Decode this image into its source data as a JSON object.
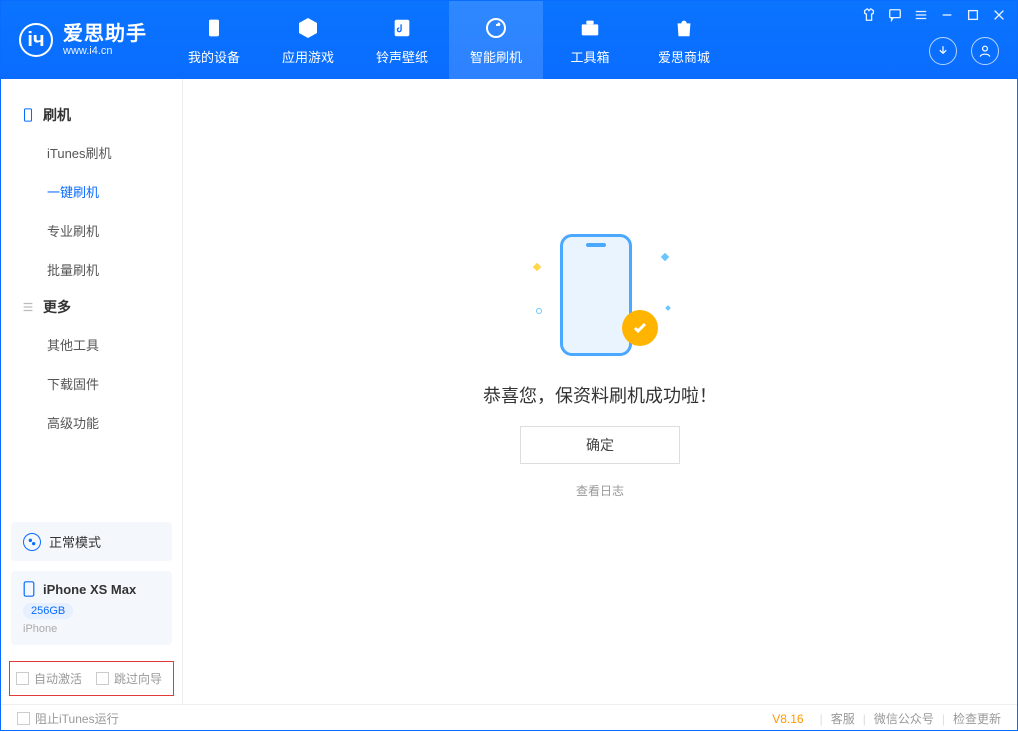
{
  "app": {
    "title": "爱思助手",
    "url": "www.i4.cn"
  },
  "nav": {
    "device": "我的设备",
    "apps": "应用游戏",
    "ringtone": "铃声壁纸",
    "flash": "智能刷机",
    "toolbox": "工具箱",
    "store": "爱思商城"
  },
  "sidebar": {
    "group_flash": "刷机",
    "items_flash": {
      "itunes": "iTunes刷机",
      "onekey": "一键刷机",
      "pro": "专业刷机",
      "batch": "批量刷机"
    },
    "group_more": "更多",
    "items_more": {
      "other": "其他工具",
      "firmware": "下载固件",
      "advanced": "高级功能"
    }
  },
  "device": {
    "mode": "正常模式",
    "name": "iPhone XS Max",
    "storage": "256GB",
    "type": "iPhone"
  },
  "options": {
    "auto_activate": "自动激活",
    "skip_guide": "跳过向导"
  },
  "main": {
    "success": "恭喜您，保资料刷机成功啦！",
    "confirm": "确定",
    "view_log": "查看日志"
  },
  "footer": {
    "block_itunes": "阻止iTunes运行",
    "version": "V8.16",
    "support": "客服",
    "wechat": "微信公众号",
    "update": "检查更新"
  }
}
